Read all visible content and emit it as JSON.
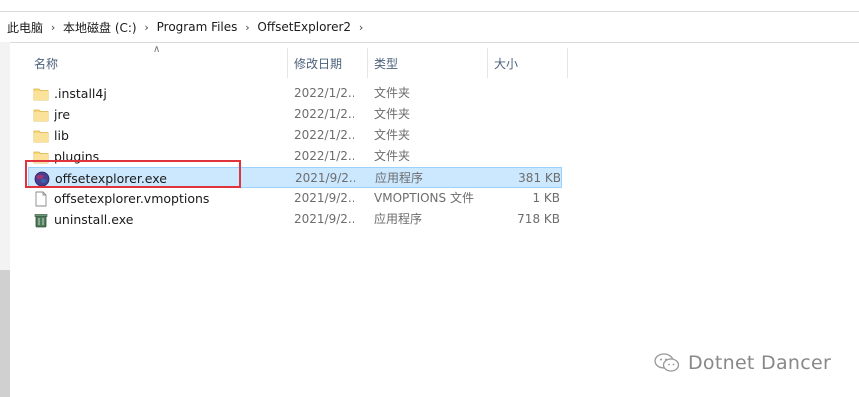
{
  "breadcrumb": {
    "items": [
      "此电脑",
      "本地磁盘 (C:)",
      "Program Files",
      "OffsetExplorer2"
    ]
  },
  "columns": {
    "name": "名称",
    "date": "修改日期",
    "type": "类型",
    "size": "大小"
  },
  "files": [
    {
      "name": ".install4j",
      "date": "2022/1/2...",
      "type": "文件夹",
      "size": "",
      "icon": "folder-icon"
    },
    {
      "name": "jre",
      "date": "2022/1/2...",
      "type": "文件夹",
      "size": "",
      "icon": "folder-icon"
    },
    {
      "name": "lib",
      "date": "2022/1/2...",
      "type": "文件夹",
      "size": "",
      "icon": "folder-icon"
    },
    {
      "name": "plugins",
      "date": "2022/1/2...",
      "type": "文件夹",
      "size": "",
      "icon": "folder-icon"
    },
    {
      "name": "offsetexplorer.exe",
      "date": "2021/9/2...",
      "type": "应用程序",
      "size": "381 KB",
      "icon": "app-icon",
      "selected": true
    },
    {
      "name": "offsetexplorer.vmoptions",
      "date": "2021/9/2...",
      "type": "VMOPTIONS 文件",
      "size": "1 KB",
      "icon": "file-icon"
    },
    {
      "name": "uninstall.exe",
      "date": "2021/9/2...",
      "type": "应用程序",
      "size": "718 KB",
      "icon": "uninstall-icon"
    }
  ],
  "watermark": {
    "text": "Dotnet Dancer",
    "icon": "wechat-icon"
  },
  "colors": {
    "selection_bg": "#cce8ff",
    "selection_border": "#99d1ff",
    "highlight": "#e1333b",
    "folder": "#f8d775",
    "header_text": "#4c607a"
  }
}
